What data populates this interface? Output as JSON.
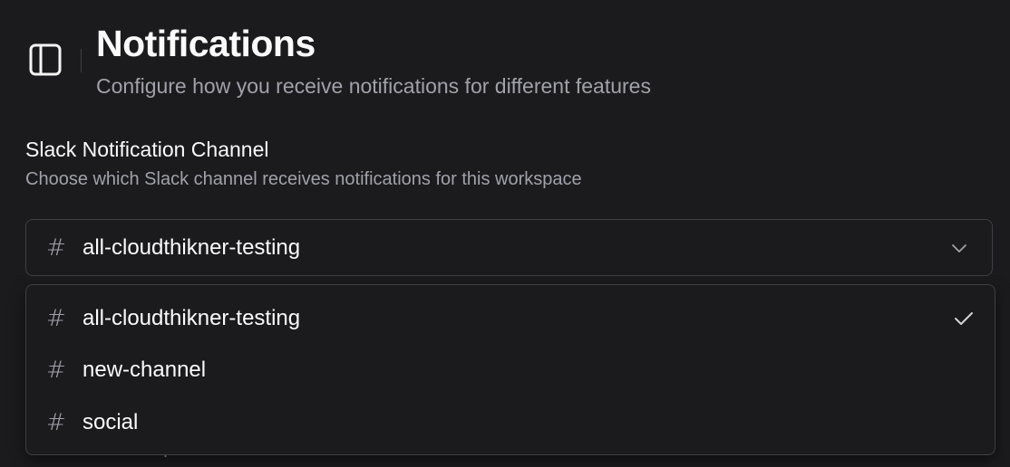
{
  "header": {
    "title": "Notifications",
    "subtitle": "Configure how you receive notifications for different features",
    "sidebar_toggle_icon": "panel-left-icon"
  },
  "slack": {
    "title": "Slack Notification Channel",
    "description": "Choose which Slack channel receives notifications for this workspace",
    "selected_value": "all-cloudthikner-testing",
    "options": [
      {
        "label": "all-cloudthikner-testing",
        "selected": true
      },
      {
        "label": "new-channel",
        "selected": false
      },
      {
        "label": "social",
        "selected": false
      }
    ]
  },
  "obscured_text": "Customize workspace members",
  "icons": {
    "channel": "hash-icon",
    "expand": "chevron-down-icon",
    "selected": "check-icon"
  },
  "colors": {
    "background": "#1b1b1d",
    "text": "#fafafa",
    "muted": "#a1a1aa",
    "border": "#3f3f46"
  }
}
